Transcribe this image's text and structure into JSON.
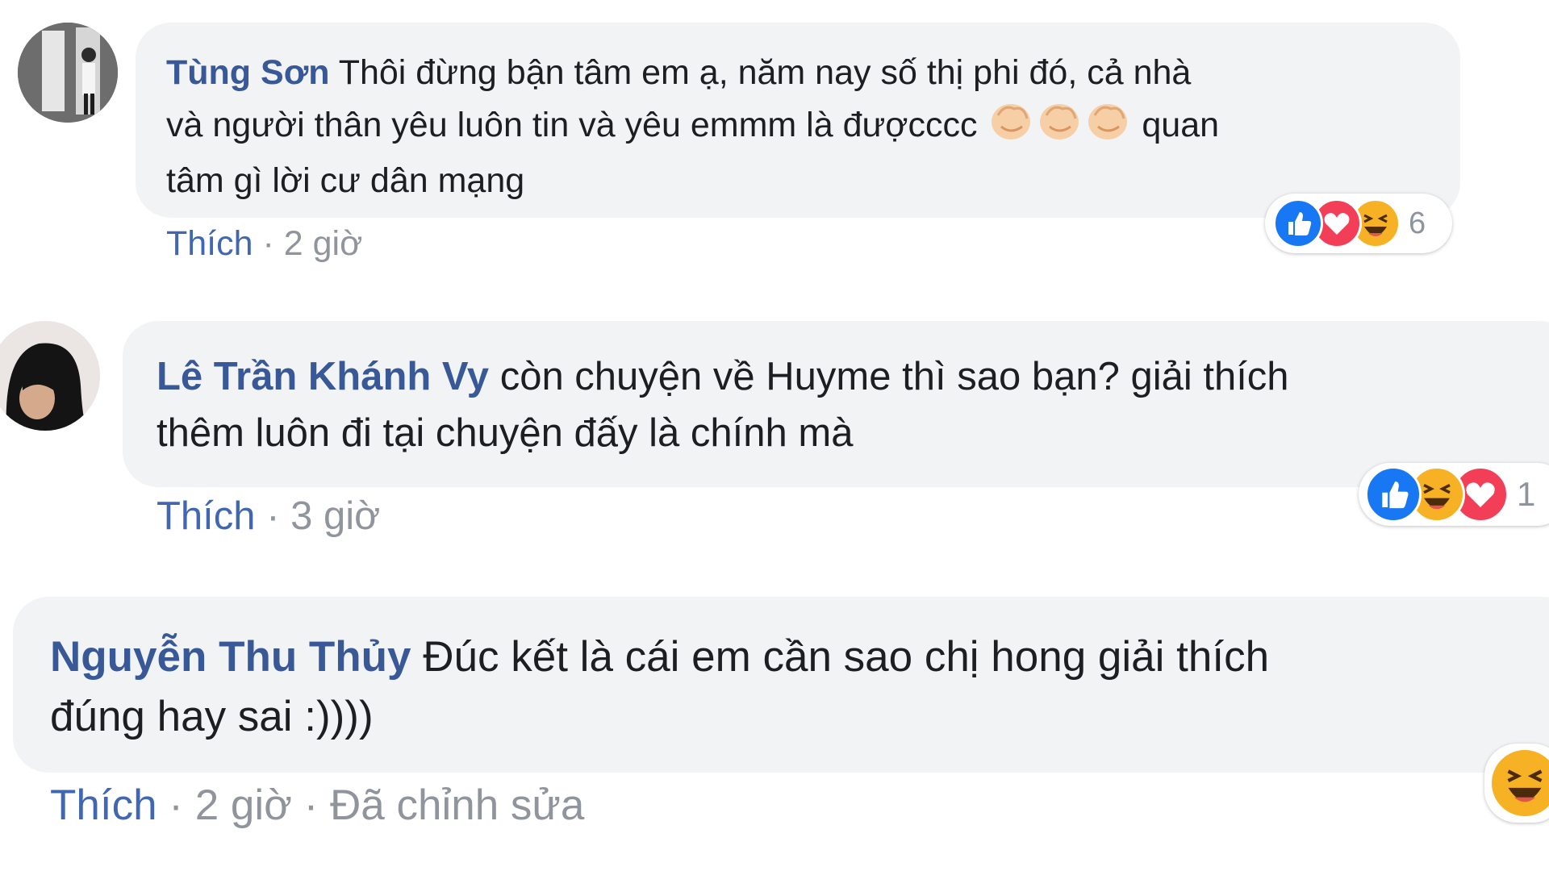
{
  "comments": [
    {
      "author": "Tùng Sơn",
      "text_line1": "Thôi đừng bận tâm em ạ, năm nay số thị phi đó, cả nhà",
      "text_line2a": "và người thân yêu luôn tin và yêu emmm là đượcccc",
      "text_line2b": "quan",
      "text_line3": "tâm gì lời cư dân mạng",
      "emoji": [
        "clapping-hands",
        "clapping-hands",
        "clapping-hands"
      ],
      "like_label": "Thích",
      "sep": "·",
      "time": "2 giờ",
      "edited": "",
      "reactions": [
        "like",
        "love",
        "haha"
      ],
      "reaction_count": "6"
    },
    {
      "author": "Lê Trần Khánh Vy",
      "text_line1": "còn chuyện về Huyme thì sao bạn? giải thích",
      "text_line2": "thêm luôn đi tại chuyện đấy là chính mà",
      "like_label": "Thích",
      "sep": "·",
      "time": "3 giờ",
      "edited": "",
      "reactions": [
        "like",
        "haha",
        "love"
      ],
      "reaction_count": "1"
    },
    {
      "author": "Nguyễn Thu Thủy",
      "text_line1": "Đúc kết là cái em cần sao chị hong giải thích",
      "text_line2": "đúng hay sai :))))",
      "like_label": "Thích",
      "sep": "·",
      "time": "2 giờ",
      "sep2": "·",
      "edited": "Đã chỉnh sửa",
      "reactions": [
        "haha"
      ]
    }
  ],
  "colors": {
    "name": "#385898",
    "like_link": "#4267b2",
    "meta": "#90949c",
    "bubble": "#f2f3f5",
    "like_reaction": "#1877f2",
    "love_reaction": "#f33e58",
    "haha_reaction": "#f7b125"
  }
}
